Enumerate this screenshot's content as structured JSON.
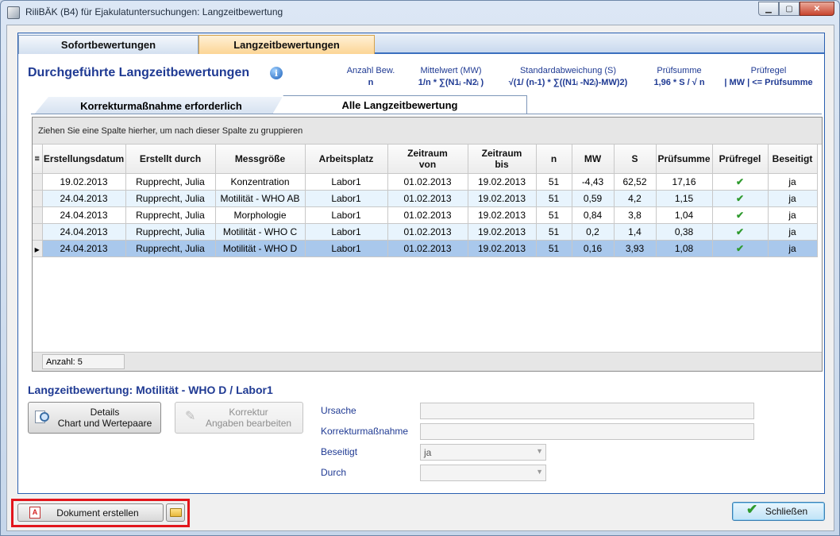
{
  "window": {
    "title": "RiliBÄK (B4) für Ejakulatuntersuchungen: Langzeitbewertung"
  },
  "tabs": [
    "Sofortbewertungen",
    "Langzeitbewertungen"
  ],
  "section_title": "Durchgeführte Langzeitbewertungen",
  "formulas": [
    {
      "label": "Anzahl Bew.",
      "expr": "n"
    },
    {
      "label": "Mittelwert (MW)",
      "expr": "1/n * ∑(N1ᵢ -N2ᵢ )"
    },
    {
      "label": "Standardabweichung (S)",
      "expr": "√(1/ (n-1) * ∑((N1ᵢ -N2ᵢ)-MW)2)"
    },
    {
      "label": "Prüfsumme",
      "expr": "1,96 * S / √ n"
    },
    {
      "label": "Prüfregel",
      "expr": "| MW |  <= Prüfsumme"
    }
  ],
  "sub_tabs": [
    "Korrekturmaßnahme erforderlich",
    "Alle Langzeitbewertung"
  ],
  "grid": {
    "group_hint": "Ziehen Sie eine Spalte hierher, um nach dieser Spalte zu gruppieren",
    "columns": [
      "Erstellungsdatum",
      "Erstellt durch",
      "Messgröße",
      "Arbeitsplatz",
      "Zeitraum von",
      "Zeitraum bis",
      "n",
      "MW",
      "S",
      "Prüfsumme",
      "Prüfregel",
      "Beseitigt"
    ],
    "column_lines": [
      [
        "Erstellungsdatum"
      ],
      [
        "Erstellt durch"
      ],
      [
        "Messgröße"
      ],
      [
        "Arbeitsplatz"
      ],
      [
        "Zeitraum",
        "von"
      ],
      [
        "Zeitraum",
        "bis"
      ],
      [
        "n"
      ],
      [
        "MW"
      ],
      [
        "S"
      ],
      [
        "Prüfsumme"
      ],
      [
        "Prüfregel"
      ],
      [
        "Beseitigt"
      ]
    ],
    "rows": [
      [
        "19.02.2013",
        "Rupprecht, Julia",
        "Konzentration",
        "Labor1",
        "01.02.2013",
        "19.02.2013",
        "51",
        "-4,43",
        "62,52",
        "17,16",
        "✔",
        "ja"
      ],
      [
        "24.04.2013",
        "Rupprecht, Julia",
        "Motilität - WHO AB",
        "Labor1",
        "01.02.2013",
        "19.02.2013",
        "51",
        "0,59",
        "4,2",
        "1,15",
        "✔",
        "ja"
      ],
      [
        "24.04.2013",
        "Rupprecht, Julia",
        "Morphologie",
        "Labor1",
        "01.02.2013",
        "19.02.2013",
        "51",
        "0,84",
        "3,8",
        "1,04",
        "✔",
        "ja"
      ],
      [
        "24.04.2013",
        "Rupprecht, Julia",
        "Motilität - WHO C",
        "Labor1",
        "01.02.2013",
        "19.02.2013",
        "51",
        "0,2",
        "1,4",
        "0,38",
        "✔",
        "ja"
      ],
      [
        "24.04.2013",
        "Rupprecht, Julia",
        "Motilität - WHO D",
        "Labor1",
        "01.02.2013",
        "19.02.2013",
        "51",
        "0,16",
        "3,93",
        "1,08",
        "✔",
        "ja"
      ]
    ],
    "selected_row": 4,
    "count_label": "Anzahl: 5"
  },
  "detail": {
    "title": "Langzeitbewertung:  Motilität - WHO D / Labor1",
    "details_button": [
      "Details",
      "Chart und Wertepaare"
    ],
    "korrektur_button": [
      "Korrektur",
      "Angaben bearbeiten"
    ],
    "fields": [
      {
        "label": "Ursache",
        "value": ""
      },
      {
        "label": "Korrekturmaßnahme",
        "value": ""
      },
      {
        "label": "Beseitigt",
        "value": "ja"
      },
      {
        "label": "Durch",
        "value": ""
      }
    ]
  },
  "footer": {
    "document_button": "Dokument erstellen",
    "close_button": "Schließen"
  },
  "colors": {
    "accent": "#1f3a93",
    "selected_row": "#a9c8ec",
    "check": "#2e9a2e",
    "highlight_frame": "#e2161c"
  }
}
